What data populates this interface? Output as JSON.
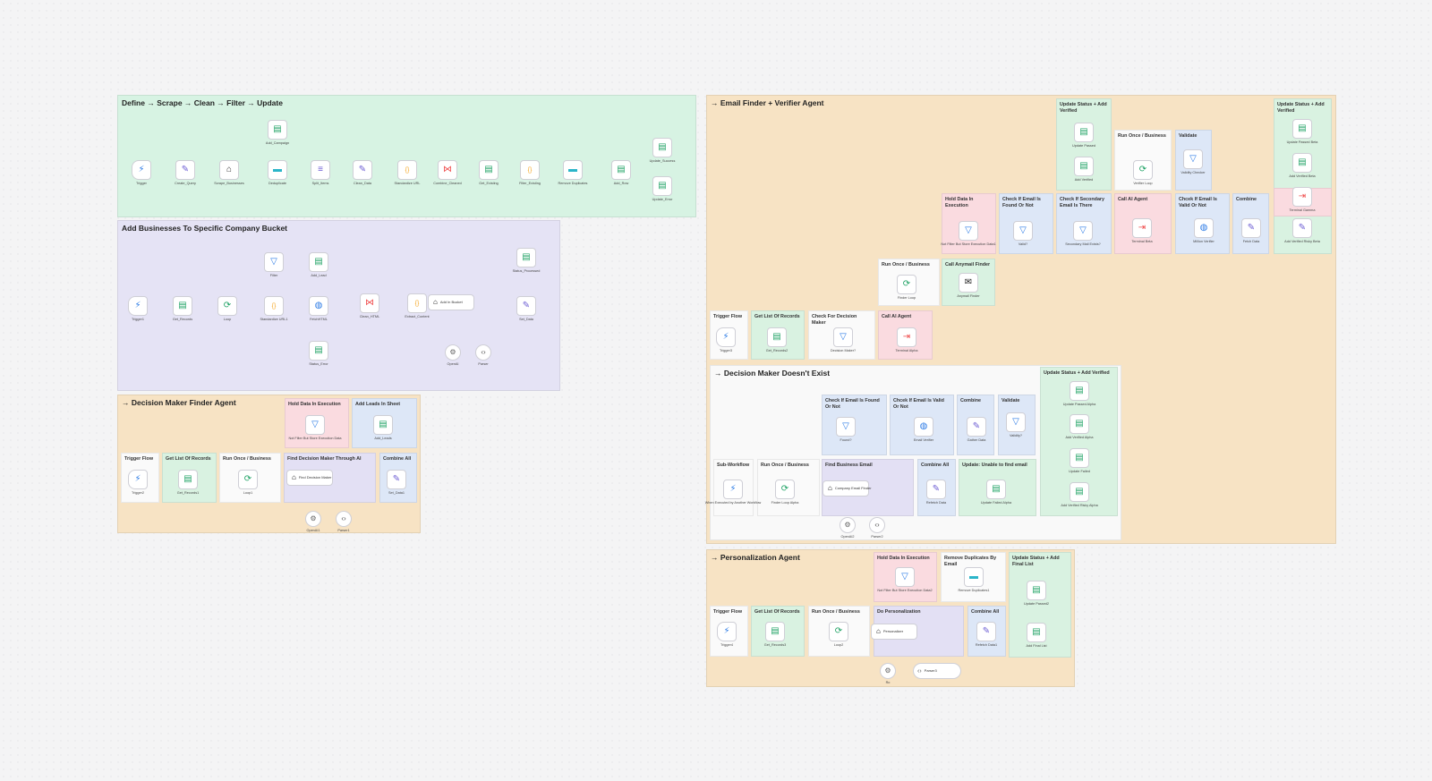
{
  "colors": {
    "green_group": "#d7f3e3",
    "purple_group": "#e5e3f5",
    "orange_group": "#f7e3c4",
    "white_group": "#f9f9f9",
    "sticky_green": "#d9f2e1",
    "sticky_blue": "#dde7f7",
    "sticky_pink": "#fadbe0",
    "sticky_purple": "#e3e0f4",
    "sticky_white": "#fafafa",
    "edge": "#b9b9c2",
    "node_green": "#21a366",
    "node_purple": "#6c5dd3",
    "node_orange": "#f5a623",
    "node_red": "#ef4d4d",
    "node_blue": "#2c7be5"
  },
  "groups": {
    "g1": "Define → Scrape → Clean → Filter → Update",
    "g2": "Add Businesses To Specific Company Bucket",
    "g3": "→ Decision Maker Finder Agent",
    "g4": "→ Email Finder + Verifier Agent",
    "g5": "→ Decision Maker Doesn't Exist",
    "g6": "→ Personalization Agent"
  },
  "stickies": {
    "dm_hold": "Hold Data In Execution",
    "dm_addleads": "Add Leads In Sheet",
    "dm_trigger": "Trigger Flow",
    "dm_getlist": "Get List Of Records",
    "dm_runonce": "Run Once / Business",
    "dm_find": "Find Decision Maker Through AI",
    "dm_combine": "Combine All",
    "ef_trigger": "Trigger Flow",
    "ef_getlist": "Get List Of Records",
    "ef_checkdm": "Check For Decision Maker",
    "ef_callai": "Call AI Agent",
    "ef_runonce": "Run Once / Business",
    "ef_anymail": "Call Anymail Finder",
    "ef_hold": "Hold Data In Execution",
    "ef_checkemail": "Check If Email Is Found Or Not",
    "ef_secondary": "Check If Secondary Email Is There",
    "ef_callai2": "Call AI Agent",
    "ef_valid": "Chcek If Email Is Valid Or Not",
    "ef_combine": "Combine",
    "ef_runonce2": "Run Once / Business",
    "ef_validate": "Validate",
    "ef_update1": "Update Status + Add Verified",
    "ef_update2": "Update Status + Add Verified",
    "nx_sub": "Sub-Workflow",
    "nx_runonce": "Run Once / Business",
    "nx_findemail": "Find Business Email",
    "nx_combineall": "Combine All",
    "nx_unable": "Update: Unable to find email",
    "nx_checkfound": "Check If Email Is Found Or Not",
    "nx_checkvalid": "Chcek If Email Is Valid Or Not",
    "nx_combine": "Combine",
    "nx_validate": "Validate",
    "nx_update": "Update Status + Add Verified",
    "p_hold": "Hold Data In Execution",
    "p_remove": "Remove Duplicates By Email",
    "p_update": "Update Status + Add Final List",
    "p_trigger": "Trigger Flow",
    "p_getlist": "Get List Of Records",
    "p_runonce": "Run Once / Business",
    "p_do": "Do Personalization",
    "p_combine": "Combine All"
  },
  "nodes": {
    "trigger": "Trigger",
    "create_query": "Create_Query",
    "scrape_businesses": "Scrape_Businesses",
    "add_campaign": "Add_Campaign",
    "deduplicate": "Deduplicate",
    "split_items": "Split_Items",
    "clean_data": "Clean_Data",
    "standardize_url": "Standardize URL",
    "combine_cleaned": "Combine_Cleaned",
    "get_existing": "Get_Existing",
    "filter_existing": "Filter_Existing",
    "remove_duplicates": "Remove Duplicates",
    "add_row": "Add_Row",
    "update_success": "Update_Success",
    "update_error": "Update_Error",
    "trigger1": "Trigger1",
    "get_records": "Get_Records",
    "loop": "Loop",
    "filter": "Filter",
    "add_lead": "Add_Lead",
    "standardize_url1": "Standardize URL1",
    "fetchhtml": "FetchHTML",
    "status_error": "Status_Error",
    "clean_html": "Clean_HTML",
    "extract_content": "Extract_Content",
    "add_in_bucket": "Add In Bucket",
    "openai": "OpenAI",
    "parser": "Parser",
    "status_processed": "Status_Processed",
    "set_data": "Set_Data",
    "trigger2": "Trigger2",
    "get_records1": "Get_Records1",
    "loop1": "Loop1",
    "not_filter": "Not Filter But Store Execution Data",
    "add_leads": "Add_Leads",
    "find_decision_maker": "Find Decision Maker",
    "set_data1": "Set_Data1",
    "openai1": "OpenAI1",
    "parser1": "Parser1",
    "trigger3": "Trigger3",
    "get_records2": "Get_Records2",
    "decision_maker": "Decision Maker?",
    "terminal_alpha": "Terminal Alpha",
    "finder_loop": "Finder Loop",
    "anymail_finder": "Anymail Finder",
    "not_filter1": "Not Filter But Store Execution Data1",
    "valid": "Valid?",
    "secondary_mail": "Secondary Mail Exists?",
    "terminal_beta": "Terminal Beta",
    "million_verifier": "Million Verifier",
    "fetch_data": "Fetch Data",
    "verifier_loop": "Verifier Loop",
    "validity_checker": "Validity Checker",
    "update_passed": "Update Passed",
    "add_verified": "Add Verified",
    "update_passed_beta": "Update Passed Beta",
    "add_verified_beta": "Add Verified Beta",
    "terminal_gamma": "Terminal Gamma",
    "add_verified_risky_beta": "Add Verified Risky Beta",
    "when_executed": "When Executed by Another Workflow",
    "finder_loop_alpha": "Finder Loop Alpha",
    "company_email_finder": "Company Email Finder",
    "openai2": "OpenAI2",
    "parser2": "Parser2",
    "refetch_data": "Refetch Data",
    "update_failed_alpha": "Update Failed Alpha",
    "found": "Found?",
    "email_verifier": "Email Verifier",
    "gather_data": "Gather Data",
    "validity": "Validity?",
    "update_passed_alpha": "Update Passed Alpha",
    "add_verified_alpha": "Add Verified Alpha",
    "update_failed": "Update Failed",
    "add_verified_risky_alpha": "Add Verified Risky Alpha",
    "not_filter2": "Not Filter But Store Execution Data2",
    "remove_duplicates1": "Remove Duplicates1",
    "update_passed2": "Update Passed2",
    "add_final_list": "Add Final List",
    "trigger4": "Trigger4",
    "get_records3": "Get_Records3",
    "loop2": "Loop2",
    "personalizer": "Personalizer",
    "refetch_data1": "Refetch Data1",
    "parser3": "Parser3",
    "ro": "Ro"
  },
  "icons": {
    "sheets": "sheets-icon",
    "edit": "edit-icon",
    "code": "code-icon",
    "loop": "loop-icon",
    "filter": "filter-icon",
    "globe": "globe-icon",
    "ai": "ai-agent-icon",
    "openai": "openai-icon",
    "parser": "parser-icon",
    "split": "split-icon",
    "merge": "merge-icon",
    "terminal": "terminal-icon",
    "trigger": "trigger-icon"
  }
}
